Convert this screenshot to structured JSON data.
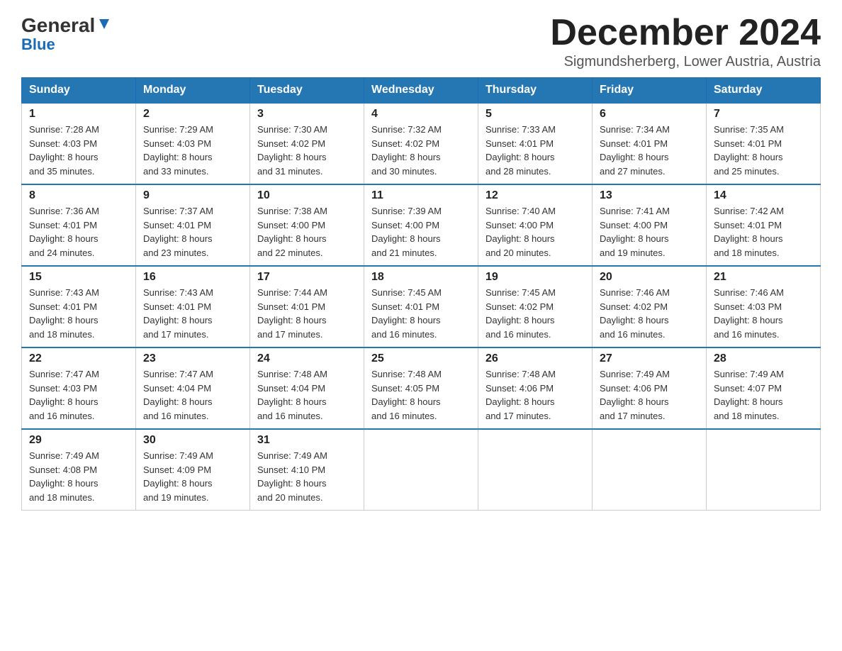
{
  "header": {
    "logo_general": "General",
    "logo_blue": "Blue",
    "month_title": "December 2024",
    "location": "Sigmundsherberg, Lower Austria, Austria"
  },
  "days_of_week": [
    "Sunday",
    "Monday",
    "Tuesday",
    "Wednesday",
    "Thursday",
    "Friday",
    "Saturday"
  ],
  "weeks": [
    [
      {
        "day": "1",
        "sunrise": "7:28 AM",
        "sunset": "4:03 PM",
        "daylight": "8 hours and 35 minutes."
      },
      {
        "day": "2",
        "sunrise": "7:29 AM",
        "sunset": "4:03 PM",
        "daylight": "8 hours and 33 minutes."
      },
      {
        "day": "3",
        "sunrise": "7:30 AM",
        "sunset": "4:02 PM",
        "daylight": "8 hours and 31 minutes."
      },
      {
        "day": "4",
        "sunrise": "7:32 AM",
        "sunset": "4:02 PM",
        "daylight": "8 hours and 30 minutes."
      },
      {
        "day": "5",
        "sunrise": "7:33 AM",
        "sunset": "4:01 PM",
        "daylight": "8 hours and 28 minutes."
      },
      {
        "day": "6",
        "sunrise": "7:34 AM",
        "sunset": "4:01 PM",
        "daylight": "8 hours and 27 minutes."
      },
      {
        "day": "7",
        "sunrise": "7:35 AM",
        "sunset": "4:01 PM",
        "daylight": "8 hours and 25 minutes."
      }
    ],
    [
      {
        "day": "8",
        "sunrise": "7:36 AM",
        "sunset": "4:01 PM",
        "daylight": "8 hours and 24 minutes."
      },
      {
        "day": "9",
        "sunrise": "7:37 AM",
        "sunset": "4:01 PM",
        "daylight": "8 hours and 23 minutes."
      },
      {
        "day": "10",
        "sunrise": "7:38 AM",
        "sunset": "4:00 PM",
        "daylight": "8 hours and 22 minutes."
      },
      {
        "day": "11",
        "sunrise": "7:39 AM",
        "sunset": "4:00 PM",
        "daylight": "8 hours and 21 minutes."
      },
      {
        "day": "12",
        "sunrise": "7:40 AM",
        "sunset": "4:00 PM",
        "daylight": "8 hours and 20 minutes."
      },
      {
        "day": "13",
        "sunrise": "7:41 AM",
        "sunset": "4:00 PM",
        "daylight": "8 hours and 19 minutes."
      },
      {
        "day": "14",
        "sunrise": "7:42 AM",
        "sunset": "4:01 PM",
        "daylight": "8 hours and 18 minutes."
      }
    ],
    [
      {
        "day": "15",
        "sunrise": "7:43 AM",
        "sunset": "4:01 PM",
        "daylight": "8 hours and 18 minutes."
      },
      {
        "day": "16",
        "sunrise": "7:43 AM",
        "sunset": "4:01 PM",
        "daylight": "8 hours and 17 minutes."
      },
      {
        "day": "17",
        "sunrise": "7:44 AM",
        "sunset": "4:01 PM",
        "daylight": "8 hours and 17 minutes."
      },
      {
        "day": "18",
        "sunrise": "7:45 AM",
        "sunset": "4:01 PM",
        "daylight": "8 hours and 16 minutes."
      },
      {
        "day": "19",
        "sunrise": "7:45 AM",
        "sunset": "4:02 PM",
        "daylight": "8 hours and 16 minutes."
      },
      {
        "day": "20",
        "sunrise": "7:46 AM",
        "sunset": "4:02 PM",
        "daylight": "8 hours and 16 minutes."
      },
      {
        "day": "21",
        "sunrise": "7:46 AM",
        "sunset": "4:03 PM",
        "daylight": "8 hours and 16 minutes."
      }
    ],
    [
      {
        "day": "22",
        "sunrise": "7:47 AM",
        "sunset": "4:03 PM",
        "daylight": "8 hours and 16 minutes."
      },
      {
        "day": "23",
        "sunrise": "7:47 AM",
        "sunset": "4:04 PM",
        "daylight": "8 hours and 16 minutes."
      },
      {
        "day": "24",
        "sunrise": "7:48 AM",
        "sunset": "4:04 PM",
        "daylight": "8 hours and 16 minutes."
      },
      {
        "day": "25",
        "sunrise": "7:48 AM",
        "sunset": "4:05 PM",
        "daylight": "8 hours and 16 minutes."
      },
      {
        "day": "26",
        "sunrise": "7:48 AM",
        "sunset": "4:06 PM",
        "daylight": "8 hours and 17 minutes."
      },
      {
        "day": "27",
        "sunrise": "7:49 AM",
        "sunset": "4:06 PM",
        "daylight": "8 hours and 17 minutes."
      },
      {
        "day": "28",
        "sunrise": "7:49 AM",
        "sunset": "4:07 PM",
        "daylight": "8 hours and 18 minutes."
      }
    ],
    [
      {
        "day": "29",
        "sunrise": "7:49 AM",
        "sunset": "4:08 PM",
        "daylight": "8 hours and 18 minutes."
      },
      {
        "day": "30",
        "sunrise": "7:49 AM",
        "sunset": "4:09 PM",
        "daylight": "8 hours and 19 minutes."
      },
      {
        "day": "31",
        "sunrise": "7:49 AM",
        "sunset": "4:10 PM",
        "daylight": "8 hours and 20 minutes."
      },
      null,
      null,
      null,
      null
    ]
  ],
  "labels": {
    "sunrise": "Sunrise:",
    "sunset": "Sunset:",
    "daylight": "Daylight:"
  }
}
